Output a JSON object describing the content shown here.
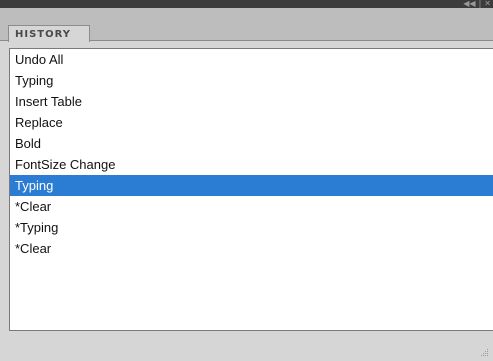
{
  "titlebar": {
    "collapse_icon": "double-chevron-left",
    "close_icon": "x"
  },
  "panel": {
    "tab_label": "HISTORY"
  },
  "history": {
    "items": [
      {
        "label": "Undo All",
        "selected": false
      },
      {
        "label": "Typing",
        "selected": false
      },
      {
        "label": "Insert Table",
        "selected": false
      },
      {
        "label": "Replace",
        "selected": false
      },
      {
        "label": "Bold",
        "selected": false
      },
      {
        "label": "FontSize Change",
        "selected": false
      },
      {
        "label": "Typing",
        "selected": true
      },
      {
        "label": "*Clear",
        "selected": false
      },
      {
        "label": "*Typing",
        "selected": false
      },
      {
        "label": "*Clear",
        "selected": false
      }
    ]
  },
  "colors": {
    "selection": "#2b7cd3",
    "panel_bg": "#d6d6d6",
    "titlebar": "#3c3c3c"
  }
}
